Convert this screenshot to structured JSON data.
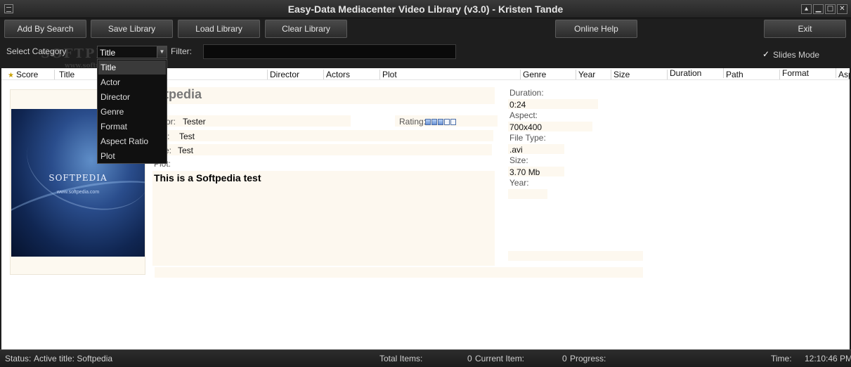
{
  "window": {
    "title": "Easy-Data Mediacenter Video Library (v3.0) - Kristen Tande",
    "controls": {
      "minimize": "▁",
      "maximize": "□",
      "close": "✕",
      "restore": "▴"
    }
  },
  "toolbar": {
    "add_by_search": "Add By Search",
    "save_library": "Save Library",
    "load_library": "Load Library",
    "clear_library": "Clear Library",
    "online_help": "Online Help",
    "exit": "Exit"
  },
  "filters": {
    "select_category_label": "Select Category",
    "category_value": "Title",
    "filter_label": "Filter:",
    "filter_value": "",
    "slides_mode_label": "Slides Mode",
    "slides_mode_checked": true
  },
  "watermark": {
    "brand": "SOFTPEDIA",
    "trademark": "™",
    "url": "www.softpedia.com"
  },
  "category_options": [
    "Title",
    "Actor",
    "Director",
    "Genre",
    "Format",
    "Aspect Ratio",
    "Plot"
  ],
  "table": {
    "columns": [
      "Score",
      "Title",
      "Director",
      "Actors",
      "Plot",
      "Genre",
      "Year",
      "Size",
      "Duration",
      "Path",
      "Format",
      "Aspe"
    ]
  },
  "detail": {
    "title": "oftpedia",
    "director_label": "ector:",
    "director_value": "Tester",
    "rating_label": "Rating:",
    "rating_value": 3,
    "rating_max": 5,
    "actors_label": "rs:",
    "actors_value": "Test",
    "genre_label": "re:",
    "genre_value": "Test",
    "plot_label": "Plot:",
    "plot_text": "This is a Softpedia test",
    "cover": {
      "title": "SOFTPEDIA",
      "subtitle": "www.softpedia.com"
    },
    "duration_label": "Duration:",
    "duration_value": "0:24",
    "aspect_label": "Aspect:",
    "aspect_value": "700x400",
    "filetype_label": "File Type:",
    "filetype_value": ".avi",
    "size_label": "Size:",
    "size_value": "3.70 Mb",
    "year_label": "Year:",
    "year_value": ""
  },
  "status": {
    "status_label": "Status:",
    "status_value": "Active title: Softpedia",
    "total_label": "Total Items:",
    "total_value": "0",
    "current_label": "Current Item:",
    "current_value": "0",
    "progress_label": "Progress:",
    "time_label": "Time:",
    "time_value": "12:10:46 PM"
  }
}
